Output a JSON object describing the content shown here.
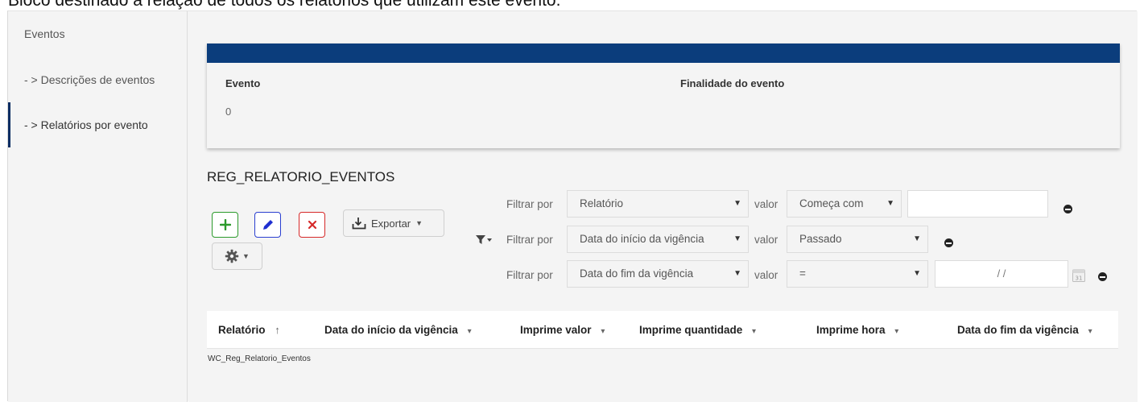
{
  "banner": {
    "text": "Bloco destinado à relação de todos os relatórios que utilizam este evento."
  },
  "sidebar": {
    "items": [
      {
        "label": "Eventos"
      },
      {
        "label": "- > Descrições de eventos"
      },
      {
        "label": "- > Relatórios por evento"
      }
    ],
    "active_index": 2
  },
  "card": {
    "col1_label": "Evento",
    "col2_label": "Finalidade do evento",
    "col1_value": "0",
    "header_color": "#0b3d7c"
  },
  "section": {
    "title": "REG_RELATORIO_EVENTOS"
  },
  "toolbar": {
    "add_icon": "plus-icon",
    "edit_icon": "pencil-icon",
    "delete_icon": "x-icon",
    "export_label": "Exportar",
    "settings_icon": "gear-icon",
    "colors": {
      "add": "#2c9a2c",
      "edit": "#2a3fd0",
      "delete": "#d62929"
    }
  },
  "filters": [
    {
      "filter_label": "Filtrar por",
      "field": "Relatório",
      "value_label": "valor",
      "operator": "Começa com",
      "input_value": ""
    },
    {
      "filter_label": "Filtrar por",
      "field": "Data do início da vigência",
      "value_label": "valor",
      "operator": "Passado"
    },
    {
      "filter_label": "Filtrar por",
      "field": "Data do fim da vigência",
      "value_label": "valor",
      "operator": "=",
      "input_value": "/ /"
    }
  ],
  "table": {
    "columns": [
      {
        "label": "Relatório",
        "sort": "↑"
      },
      {
        "label": "Data do início da vigência",
        "sort": "▾"
      },
      {
        "label": "Imprime valor",
        "sort": "▾"
      },
      {
        "label": "Imprime quantidade",
        "sort": "▾"
      },
      {
        "label": "Imprime hora",
        "sort": "▾"
      },
      {
        "label": "Data do fim da vigência",
        "sort": "▾"
      }
    ],
    "caption": "WC_Reg_Relatorio_Eventos",
    "rows": []
  }
}
